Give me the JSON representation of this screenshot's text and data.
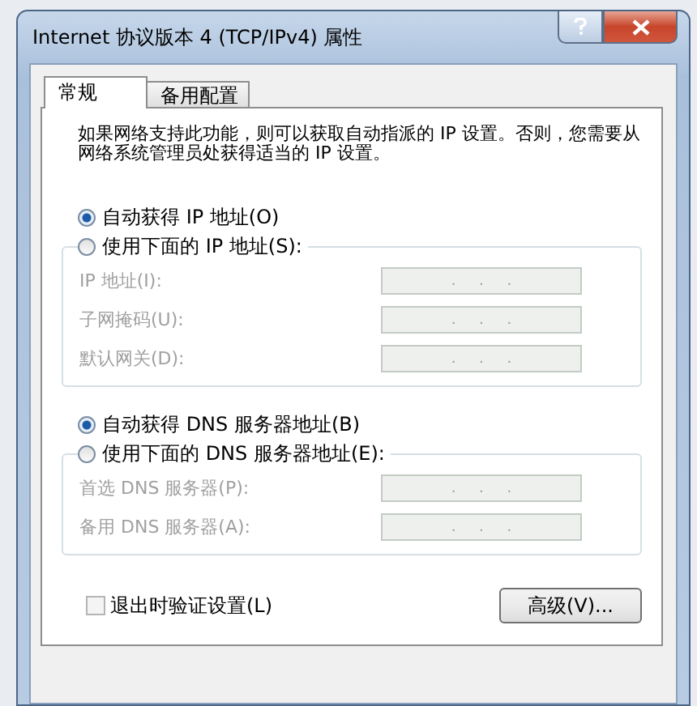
{
  "window": {
    "title": "Internet 协议版本 4 (TCP/IPv4) 属性"
  },
  "tabs": [
    {
      "label": "常规",
      "selected": true
    },
    {
      "label": "备用配置",
      "selected": false
    }
  ],
  "description": "如果网络支持此功能，则可以获取自动指派的 IP 设置。否则，您需要从网络系统管理员处获得适当的 IP 设置。",
  "ip_section": {
    "options": [
      {
        "label": "自动获得 IP 地址(O)",
        "selected": true
      },
      {
        "label": "使用下面的 IP 地址(S):",
        "selected": false
      }
    ],
    "fields": [
      {
        "label": "IP 地址(I):",
        "value": ".     .     .",
        "disabled": true
      },
      {
        "label": "子网掩码(U):",
        "value": ".     .     .",
        "disabled": true
      },
      {
        "label": "默认网关(D):",
        "value": ".     .     .",
        "disabled": true
      }
    ]
  },
  "dns_section": {
    "options": [
      {
        "label": "自动获得 DNS 服务器地址(B)",
        "selected": true
      },
      {
        "label": "使用下面的 DNS 服务器地址(E):",
        "selected": false
      }
    ],
    "fields": [
      {
        "label": "首选 DNS 服务器(P):",
        "value": ".     .     .",
        "disabled": true
      },
      {
        "label": "备用 DNS 服务器(A):",
        "value": ".     .     .",
        "disabled": true
      }
    ]
  },
  "validate": {
    "label": "退出时验证设置(L)",
    "checked": false
  },
  "advanced_button": "高级(V)..."
}
